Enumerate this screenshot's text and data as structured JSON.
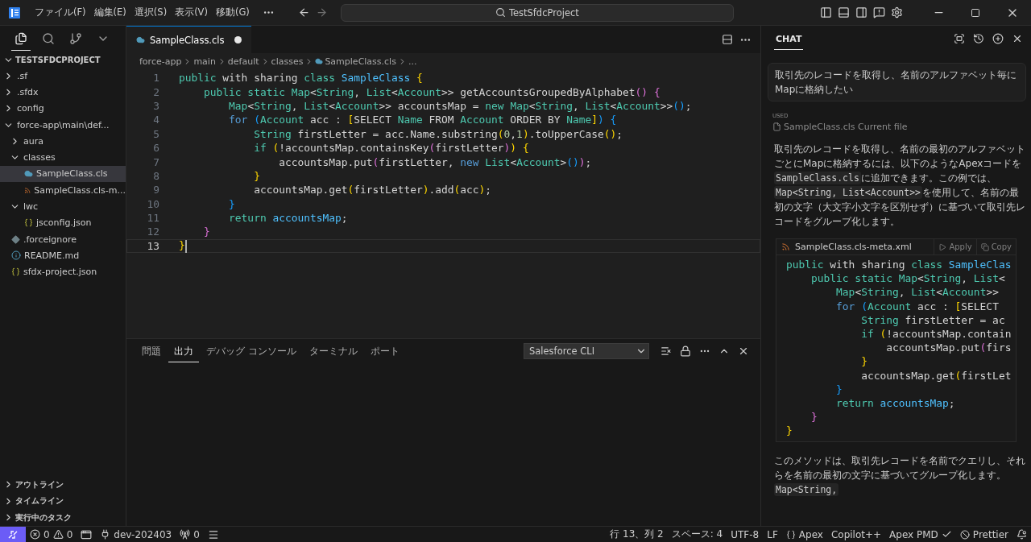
{
  "title_bar": {
    "menus": [
      "ファイル(F)",
      "編集(E)",
      "選択(S)",
      "表示(V)",
      "移動(G)"
    ],
    "search": {
      "value": "TestSfdcProject"
    }
  },
  "sidebar": {
    "project": "TESTSFDCPROJECT",
    "tree": [
      {
        "label": ".sf",
        "kind": "folder",
        "expanded": false,
        "selected": false
      },
      {
        "label": ".sfdx",
        "kind": "folder",
        "expanded": false,
        "selected": false
      },
      {
        "label": "config",
        "kind": "folder",
        "expanded": false,
        "selected": false
      },
      {
        "label": "force-app\\main\\def...",
        "kind": "folder",
        "expanded": true,
        "selected": false,
        "children": [
          {
            "label": "aura",
            "kind": "folder",
            "expanded": false,
            "selected": false
          },
          {
            "label": "classes",
            "kind": "folder",
            "expanded": true,
            "selected": false,
            "children": [
              {
                "label": "SampleClass.cls",
                "kind": "apex",
                "selected": true
              },
              {
                "label": "SampleClass.cls-m...",
                "kind": "xml",
                "selected": false
              }
            ]
          },
          {
            "label": "lwc",
            "kind": "folder",
            "expanded": true,
            "selected": false,
            "children": [
              {
                "label": "jsconfig.json",
                "kind": "json",
                "selected": false
              }
            ]
          }
        ]
      },
      {
        "label": ".forceignore",
        "kind": "ignore",
        "selected": false
      },
      {
        "label": "README.md",
        "kind": "info",
        "selected": false
      },
      {
        "label": "sfdx-project.json",
        "kind": "json",
        "selected": false
      }
    ],
    "sections": [
      {
        "label": "アウトライン",
        "expanded": false
      },
      {
        "label": "タイムライン",
        "expanded": false
      },
      {
        "label": "実行中のタスク",
        "expanded": false
      }
    ]
  },
  "editor": {
    "tab": {
      "label": "SampleClass.cls",
      "modified": true
    },
    "breadcrumbs": [
      {
        "label": "force-app",
        "kind": "folder"
      },
      {
        "label": "main",
        "kind": "folder"
      },
      {
        "label": "default",
        "kind": "folder"
      },
      {
        "label": "classes",
        "kind": "folder"
      },
      {
        "label": "SampleClass.cls",
        "kind": "file"
      },
      {
        "label": "...",
        "kind": "more"
      }
    ],
    "lines": [
      {
        "number": "1",
        "active": false,
        "tokens": [
          {
            "kind": "kw",
            "text": "public"
          },
          {
            "kind": "id",
            "text": " with sharing "
          },
          {
            "kind": "kw",
            "text": "class"
          },
          {
            "kind": "cls",
            "text": " SampleClass"
          },
          {
            "kind": "b1",
            "text": " {"
          }
        ]
      },
      {
        "number": "2",
        "active": false,
        "tokens": [
          {
            "kind": "kw",
            "text": "    public static"
          },
          {
            "kind": "type",
            "text": " Map"
          },
          {
            "kind": "id",
            "text": "<"
          },
          {
            "kind": "type",
            "text": "String"
          },
          {
            "kind": "id",
            "text": ", "
          },
          {
            "kind": "type",
            "text": "List"
          },
          {
            "kind": "id",
            "text": "<"
          },
          {
            "kind": "type",
            "text": "Account"
          },
          {
            "kind": "id",
            "text": ">> getAccountsGroupedByAlphabet"
          },
          {
            "kind": "b2",
            "text": "()"
          },
          {
            "kind": "b2",
            "text": " {"
          }
        ]
      },
      {
        "number": "3",
        "active": false,
        "tokens": [
          {
            "kind": "type",
            "text": "        Map"
          },
          {
            "kind": "id",
            "text": "<"
          },
          {
            "kind": "type",
            "text": "String"
          },
          {
            "kind": "id",
            "text": ", "
          },
          {
            "kind": "type",
            "text": "List"
          },
          {
            "kind": "id",
            "text": "<"
          },
          {
            "kind": "type",
            "text": "Account"
          },
          {
            "kind": "id",
            "text": ">> accountsMap = "
          },
          {
            "kind": "kw",
            "text": "new"
          },
          {
            "kind": "type",
            "text": " Map"
          },
          {
            "kind": "id",
            "text": "<"
          },
          {
            "kind": "type",
            "text": "String"
          },
          {
            "kind": "id",
            "text": ", "
          },
          {
            "kind": "type",
            "text": "List"
          },
          {
            "kind": "id",
            "text": "<"
          },
          {
            "kind": "type",
            "text": "Account"
          },
          {
            "kind": "id",
            "text": ">>"
          },
          {
            "kind": "b3",
            "text": "()"
          },
          {
            "kind": "id",
            "text": ";"
          }
        ]
      },
      {
        "number": "4",
        "active": false,
        "tokens": [
          {
            "kind": "ctl",
            "text": "        for"
          },
          {
            "kind": "b3",
            "text": " ("
          },
          {
            "kind": "type",
            "text": "Account"
          },
          {
            "kind": "id",
            "text": " acc : "
          },
          {
            "kind": "b1",
            "text": "["
          },
          {
            "kind": "id",
            "text": "SELECT "
          },
          {
            "kind": "type",
            "text": "Name"
          },
          {
            "kind": "id",
            "text": " FROM "
          },
          {
            "kind": "type",
            "text": "Account"
          },
          {
            "kind": "id",
            "text": " ORDER BY "
          },
          {
            "kind": "type",
            "text": "Name"
          },
          {
            "kind": "b1",
            "text": "]"
          },
          {
            "kind": "b3",
            "text": ")"
          },
          {
            "kind": "b3",
            "text": " {"
          }
        ]
      },
      {
        "number": "5",
        "active": false,
        "tokens": [
          {
            "kind": "type",
            "text": "            String"
          },
          {
            "kind": "id",
            "text": " firstLetter = acc.Name.substring"
          },
          {
            "kind": "b1",
            "text": "("
          },
          {
            "kind": "num",
            "text": "0"
          },
          {
            "kind": "id",
            "text": ","
          },
          {
            "kind": "num",
            "text": "1"
          },
          {
            "kind": "b1",
            "text": ")"
          },
          {
            "kind": "id",
            "text": ".toUpperCase"
          },
          {
            "kind": "b1",
            "text": "()"
          },
          {
            "kind": "id",
            "text": ";"
          }
        ]
      },
      {
        "number": "6",
        "active": false,
        "tokens": [
          {
            "kind": "kw",
            "text": "            if"
          },
          {
            "kind": "b1",
            "text": " ("
          },
          {
            "kind": "id",
            "text": "!accountsMap.containsKey"
          },
          {
            "kind": "b2",
            "text": "("
          },
          {
            "kind": "id",
            "text": "firstLetter"
          },
          {
            "kind": "b2",
            "text": ")"
          },
          {
            "kind": "b1",
            "text": ")"
          },
          {
            "kind": "b1",
            "text": " {"
          }
        ]
      },
      {
        "number": "7",
        "active": false,
        "tokens": [
          {
            "kind": "id",
            "text": "                accountsMap.put"
          },
          {
            "kind": "b2",
            "text": "("
          },
          {
            "kind": "id",
            "text": "firstLetter, "
          },
          {
            "kind": "ctl",
            "text": "new"
          },
          {
            "kind": "type",
            "text": " List"
          },
          {
            "kind": "id",
            "text": "<"
          },
          {
            "kind": "type",
            "text": "Account"
          },
          {
            "kind": "id",
            "text": ">"
          },
          {
            "kind": "b3",
            "text": "()"
          },
          {
            "kind": "b2",
            "text": ")"
          },
          {
            "kind": "id",
            "text": ";"
          }
        ]
      },
      {
        "number": "8",
        "active": false,
        "tokens": [
          {
            "kind": "b1",
            "text": "            }"
          }
        ]
      },
      {
        "number": "9",
        "active": false,
        "tokens": [
          {
            "kind": "id",
            "text": "            accountsMap.get"
          },
          {
            "kind": "b1",
            "text": "("
          },
          {
            "kind": "id",
            "text": "firstLetter"
          },
          {
            "kind": "b1",
            "text": ")"
          },
          {
            "kind": "id",
            "text": ".add"
          },
          {
            "kind": "b1",
            "text": "("
          },
          {
            "kind": "id",
            "text": "acc"
          },
          {
            "kind": "b1",
            "text": ")"
          },
          {
            "kind": "id",
            "text": ";"
          }
        ]
      },
      {
        "number": "10",
        "active": false,
        "tokens": [
          {
            "kind": "b3",
            "text": "        }"
          }
        ]
      },
      {
        "number": "11",
        "active": false,
        "tokens": [
          {
            "kind": "kw",
            "text": "        return"
          },
          {
            "kind": "var",
            "text": " accountsMap"
          },
          {
            "kind": "id",
            "text": ";"
          }
        ]
      },
      {
        "number": "12",
        "active": false,
        "tokens": [
          {
            "kind": "b2",
            "text": "    }"
          }
        ]
      },
      {
        "number": "13",
        "active": true,
        "tokens": [
          {
            "kind": "b1",
            "text": "}"
          }
        ]
      }
    ]
  },
  "panel": {
    "tabs": [
      {
        "label": "問題",
        "selected": false
      },
      {
        "label": "出力",
        "selected": true
      },
      {
        "label": "デバッグ コンソール",
        "selected": false
      },
      {
        "label": "ターミナル",
        "selected": false
      },
      {
        "label": "ポート",
        "selected": false
      }
    ],
    "dropdown": "Salesforce CLI"
  },
  "chat": {
    "title": "CHAT",
    "request": "取引先のレコードを取得し、名前のアルファベット毎にMapに格納したい",
    "used_label": "USED",
    "reference": "SampleClass.cls Current file",
    "answer": [
      {
        "text": "取引先のレコードを取得し、名前の最初のアルファベットごとにMapに格納するには、以下のようなApexコードを",
        "code": false
      },
      {
        "text": "SampleClass.cls",
        "code": true
      },
      {
        "text": "に追加できます。この例では、",
        "code": false
      },
      {
        "text": "Map<String, List<Account>>",
        "code": true
      },
      {
        "text": "を使用して、名前の最初の文字（大文字小文字を区別せず）に基づいて取引先レコードをグループ化します。",
        "code": false
      }
    ],
    "code_block": {
      "file": "SampleClass.cls-meta.xml",
      "actions": [
        "Apply",
        "Copy"
      ],
      "lines": [
        [
          {
            "kind": "kw",
            "text": "public"
          },
          {
            "kind": "id",
            "text": " with sharing "
          },
          {
            "kind": "kw",
            "text": "class"
          },
          {
            "kind": "cls",
            "text": " SampleClas"
          }
        ],
        [
          {
            "kind": "kw",
            "text": "    public static"
          },
          {
            "kind": "type",
            "text": " Map"
          },
          {
            "kind": "id",
            "text": "<"
          },
          {
            "kind": "type",
            "text": "String"
          },
          {
            "kind": "id",
            "text": ", "
          },
          {
            "kind": "type",
            "text": "List"
          },
          {
            "kind": "id",
            "text": "<"
          }
        ],
        [
          {
            "kind": "type",
            "text": "        Map"
          },
          {
            "kind": "id",
            "text": "<"
          },
          {
            "kind": "type",
            "text": "String"
          },
          {
            "kind": "id",
            "text": ", "
          },
          {
            "kind": "type",
            "text": "List"
          },
          {
            "kind": "id",
            "text": "<"
          },
          {
            "kind": "type",
            "text": "Account"
          },
          {
            "kind": "id",
            "text": ">>"
          }
        ],
        [
          {
            "kind": "ctl",
            "text": "        for"
          },
          {
            "kind": "b3",
            "text": " ("
          },
          {
            "kind": "type",
            "text": "Account"
          },
          {
            "kind": "id",
            "text": " acc : "
          },
          {
            "kind": "b1",
            "text": "["
          },
          {
            "kind": "id",
            "text": "SELECT"
          }
        ],
        [
          {
            "kind": "type",
            "text": "            String"
          },
          {
            "kind": "id",
            "text": " firstLetter = ac"
          }
        ],
        [
          {
            "kind": "kw",
            "text": "            if"
          },
          {
            "kind": "b1",
            "text": " ("
          },
          {
            "kind": "id",
            "text": "!accountsMap.contain"
          }
        ],
        [
          {
            "kind": "id",
            "text": "                accountsMap.put"
          },
          {
            "kind": "b2",
            "text": "("
          },
          {
            "kind": "id",
            "text": "firs"
          }
        ],
        [
          {
            "kind": "b1",
            "text": "            }"
          }
        ],
        [
          {
            "kind": "id",
            "text": "            accountsMap.get"
          },
          {
            "kind": "b1",
            "text": "("
          },
          {
            "kind": "id",
            "text": "firstLet"
          }
        ],
        [
          {
            "kind": "b3",
            "text": "        }"
          }
        ],
        [
          {
            "kind": "kw",
            "text": "        return"
          },
          {
            "kind": "var",
            "text": " accountsMap"
          },
          {
            "kind": "id",
            "text": ";"
          }
        ],
        [
          {
            "kind": "b2",
            "text": "    }"
          }
        ],
        [
          {
            "kind": "b1",
            "text": "}"
          }
        ]
      ]
    },
    "answer_2": [
      {
        "text": "このメソッドは、取引先レコードを名前でクエリし、それらを名前の最初の文字に基づいてグループ化します。",
        "code": false
      },
      {
        "text": "Map<String,",
        "code": true
      }
    ]
  },
  "status_bar": {
    "left": [
      {
        "kind": "remote"
      },
      {
        "kind": "problems",
        "errors": "0",
        "warnings": "0"
      },
      {
        "kind": "layout"
      },
      {
        "kind": "org",
        "text": "dev-202403"
      },
      {
        "kind": "ports",
        "text": "0"
      },
      {
        "kind": "menu"
      }
    ],
    "right": [
      {
        "kind": "text",
        "text": "行 13、列 2"
      },
      {
        "kind": "text",
        "text": "スペース: 4"
      },
      {
        "kind": "text",
        "text": "UTF-8"
      },
      {
        "kind": "text",
        "text": "LF"
      },
      {
        "kind": "language",
        "text": "Apex"
      },
      {
        "kind": "text",
        "text": "Copilot++"
      },
      {
        "kind": "checked",
        "text": "Apex PMD"
      },
      {
        "kind": "blocked",
        "text": "Prettier"
      },
      {
        "kind": "notifications"
      }
    ]
  }
}
